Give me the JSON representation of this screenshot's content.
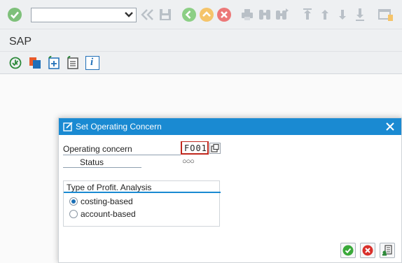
{
  "toolbar": {
    "command_value": "",
    "icons": [
      "enter-icon",
      "back-double-icon",
      "save-icon",
      "back-icon",
      "exit-icon",
      "cancel-icon",
      "print-icon",
      "find-icon",
      "find-next-icon",
      "first-page-icon",
      "previous-page-icon",
      "next-page-icon",
      "last-page-icon",
      "new-session-icon"
    ]
  },
  "title_bar": {
    "title": "SAP"
  },
  "app_toolbar": {
    "icons": [
      "execute-icon",
      "copy-objects-icon",
      "create-icon",
      "display-icon",
      "info-icon"
    ],
    "info_glyph": "i"
  },
  "dialog": {
    "title": "Set Operating Concern",
    "close_glyph": "✕",
    "operating_concern_label": "Operating concern",
    "operating_concern_value": "FO01",
    "status_label": "Status",
    "status_lights": "○○○",
    "group": {
      "title": "Type of Profit. Analysis",
      "options": [
        {
          "label": "costing-based",
          "selected": true
        },
        {
          "label": "account-based",
          "selected": false
        }
      ]
    },
    "buttons": [
      "continue-button",
      "cancel-button",
      "new-entries-button"
    ]
  },
  "colors": {
    "accent": "#1a8ad2",
    "ok_green": "#3aa93a",
    "cancel_red": "#d9302b",
    "error_border": "#c0281e"
  }
}
